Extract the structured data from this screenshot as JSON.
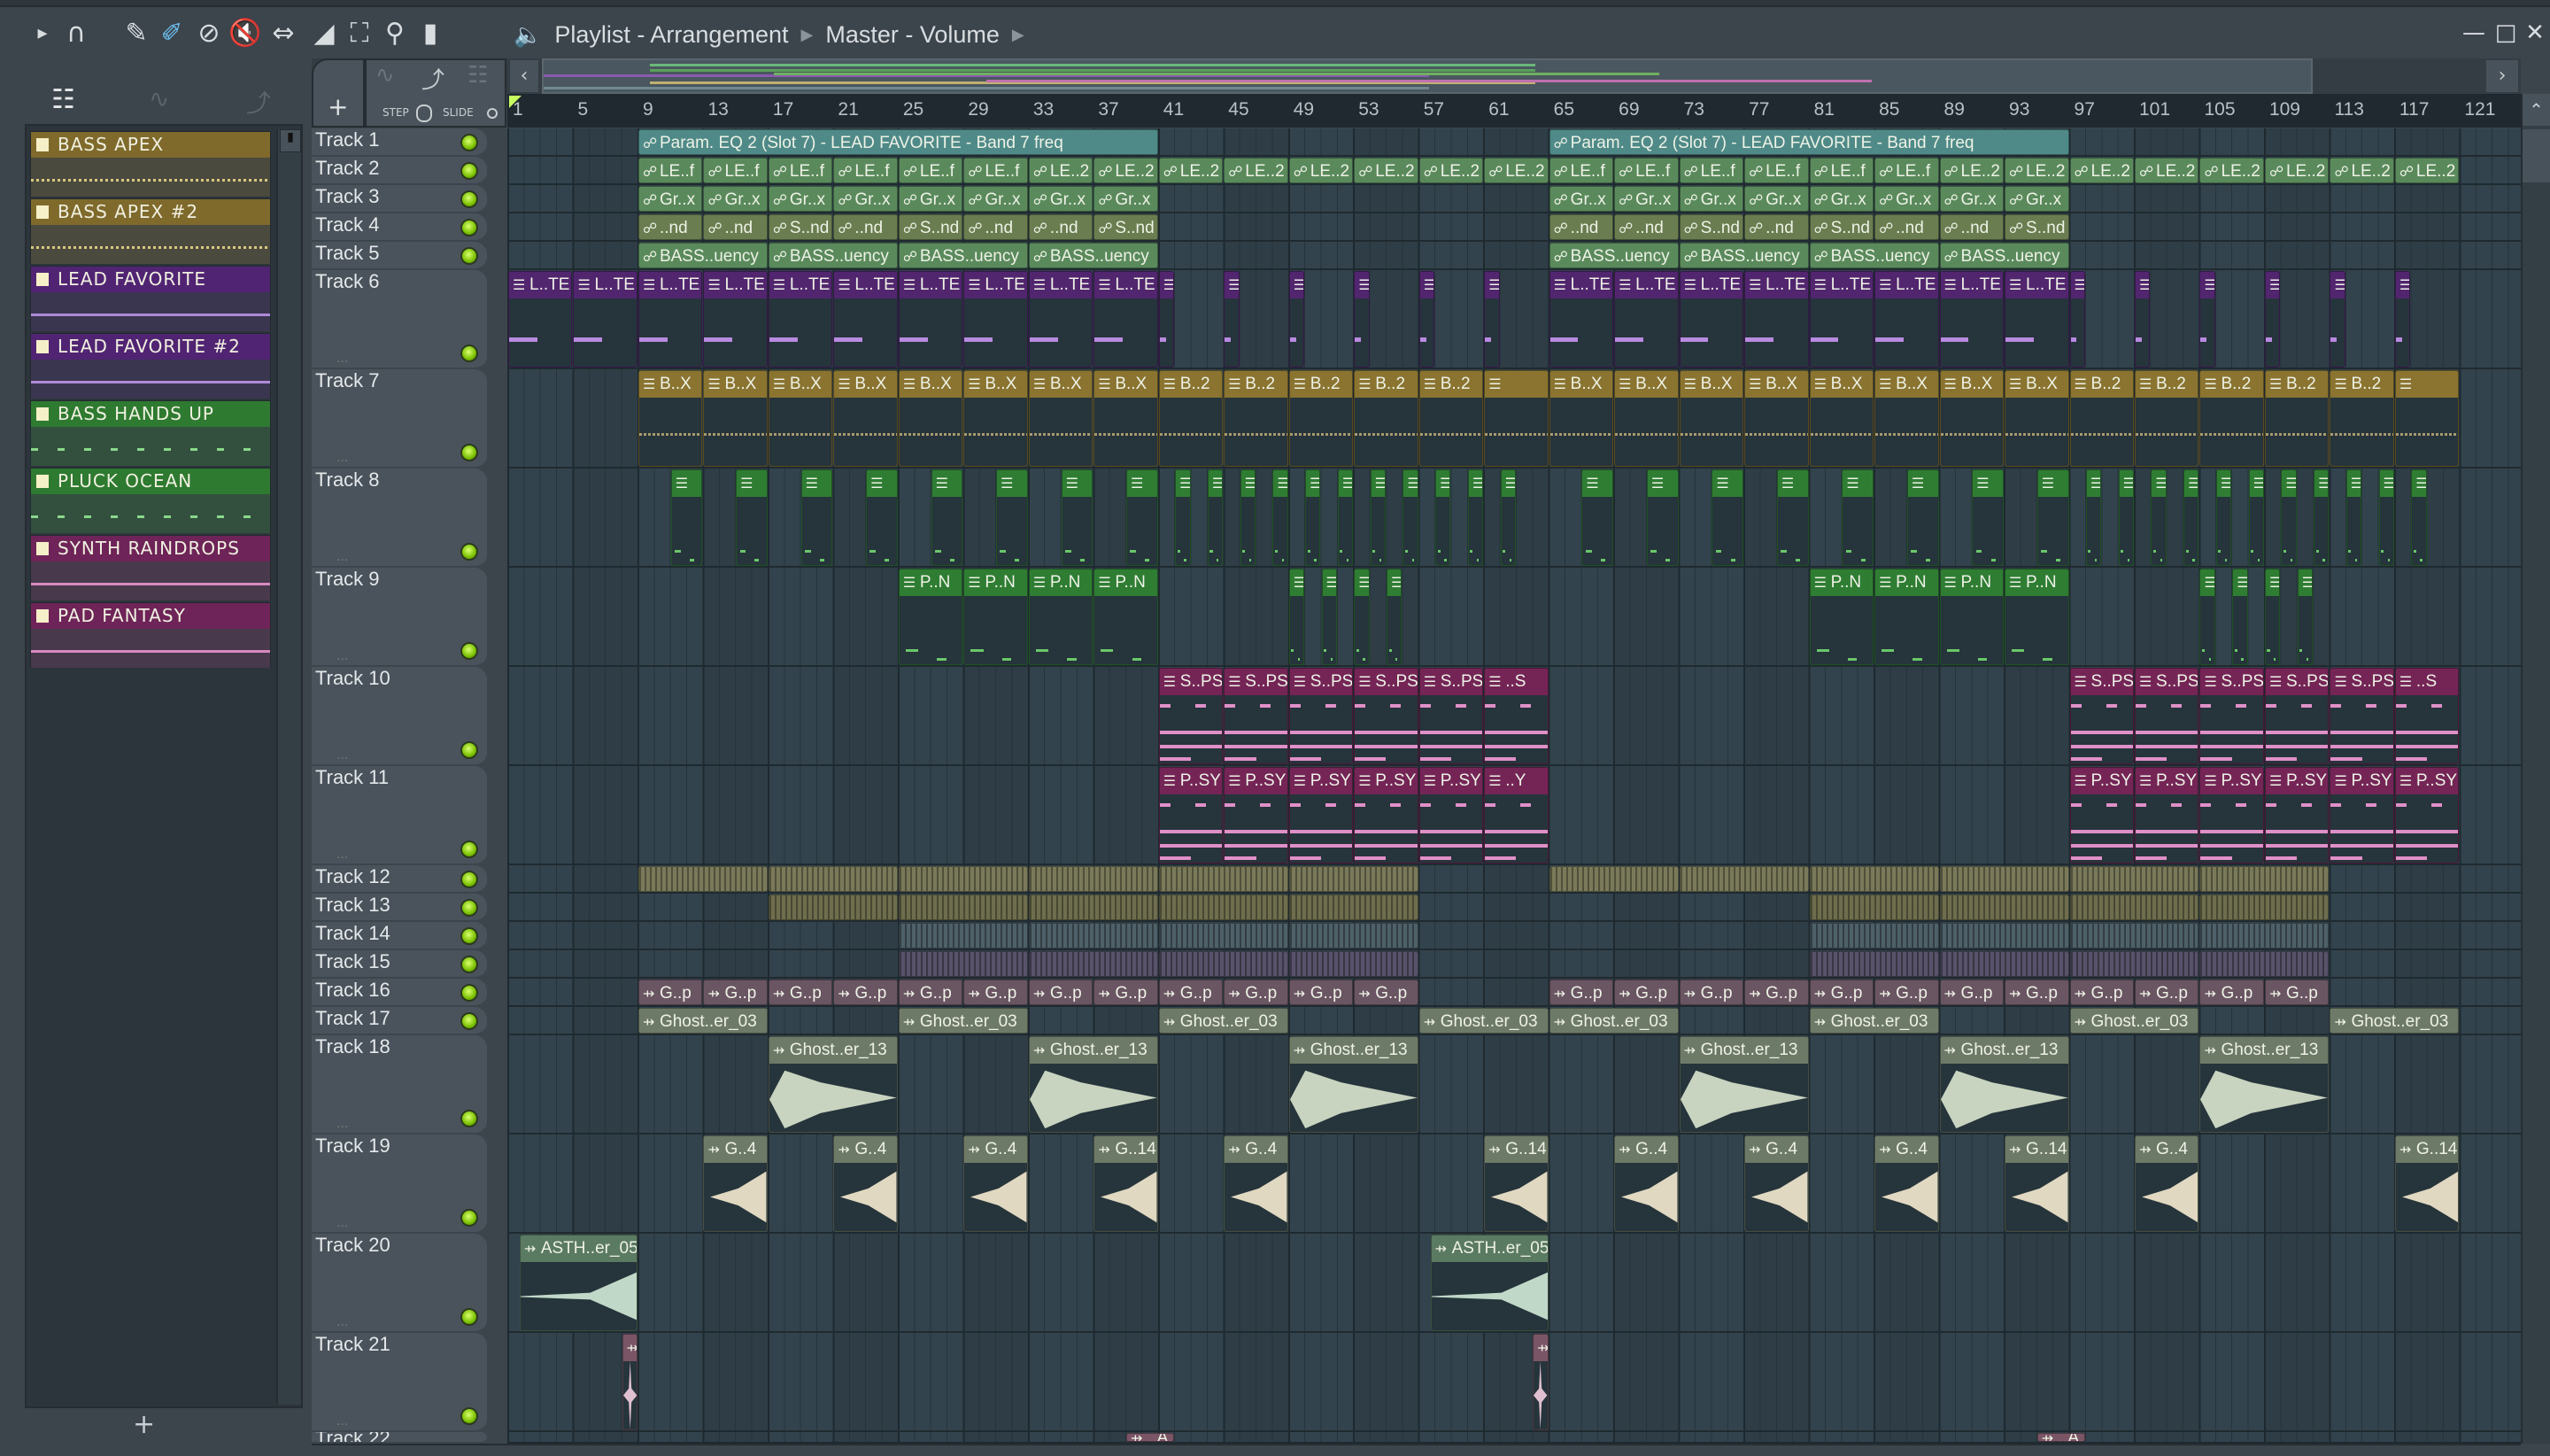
{
  "window": {
    "title_parts": [
      "Playlist - Arrangement",
      "Master - Volume"
    ]
  },
  "toolbar_icons": [
    "play-arrow-icon",
    "magnet-snap-icon",
    "pencil-icon",
    "paint-brush-icon",
    "delete-icon",
    "mute-icon",
    "slip-icon",
    "slice-icon",
    "select-icon",
    "zoom-icon",
    "playback-icon",
    "speaker-icon"
  ],
  "second_toolbar": {
    "step_label": "STEP",
    "slide_label": "SLIDE",
    "add_label": "+"
  },
  "channels": [
    {
      "name": "BASS APEX",
      "color": "#7f6a2c",
      "body": "#4b4a3f"
    },
    {
      "name": "BASS APEX #2",
      "color": "#7f6a2c",
      "body": "#4b4a3f"
    },
    {
      "name": "LEAD FAVORITE",
      "color": "#512473",
      "body": "#3b3650"
    },
    {
      "name": "LEAD FAVORITE #2",
      "color": "#512473",
      "body": "#3b3650"
    },
    {
      "name": "BASS HANDS UP",
      "color": "#2e7a30",
      "body": "#33503f"
    },
    {
      "name": "PLUCK OCEAN",
      "color": "#2e7a30",
      "body": "#33503f"
    },
    {
      "name": "SYNTH RAINDROPS",
      "color": "#6e2458",
      "body": "#48394d"
    },
    {
      "name": "PAD FANTASY",
      "color": "#6e2458",
      "body": "#48394d"
    }
  ],
  "ruler_labels": [
    "1",
    "5",
    "9",
    "13",
    "17",
    "21",
    "25",
    "29",
    "33",
    "37",
    "41",
    "45",
    "49",
    "53",
    "57",
    "61",
    "65",
    "69",
    "73",
    "77",
    "81",
    "85",
    "89",
    "93",
    "97",
    "101",
    "105",
    "109",
    "113",
    "117",
    "121"
  ],
  "palette": {
    "autoTeal": "#4f8a88",
    "autoGreen": "#5a8a5c",
    "autoOlive": "#6a7d50",
    "purple": "#52256f",
    "gold": "#8a7430",
    "green": "#2f7d33",
    "pink": "#742556",
    "olive": "#7a7a5a",
    "olive2": "#6e6e4e",
    "blue": "#4e6068",
    "violet": "#58526a",
    "mauve": "#6a5562",
    "ghost": "#6e7a68",
    "asth": "#5b7a62",
    "rose": "#7a5566"
  },
  "tracks": [
    {
      "name": "Track 1",
      "groups": [
        {
          "start": 9,
          "len": 32,
          "step": 32,
          "kind": "autoTeal",
          "labels": [
            "Param. EQ 2 (Slot 7) - LEAD FAVORITE - Band 7 freq"
          ]
        },
        {
          "start": 65,
          "len": 32,
          "step": 32,
          "kind": "autoTeal",
          "labels": [
            "Param. EQ 2 (Slot 7) - LEAD FAVORITE - Band 7 freq"
          ]
        }
      ]
    },
    {
      "name": "Track 2",
      "groups": [
        {
          "start": 9,
          "len": 4,
          "step": 4,
          "kind": "autoGreen",
          "labels": [
            "LE..f",
            "LE..f",
            "LE..f",
            "LE..f",
            "LE..f",
            "LE..f",
            "LE..2",
            "LE..2",
            "LE..2",
            "LE..2",
            "LE..2",
            "LE..2",
            "LE..2",
            "LE..2"
          ]
        },
        {
          "start": 65,
          "len": 4,
          "step": 4,
          "kind": "autoGreen",
          "labels": [
            "LE..f",
            "LE..f",
            "LE..f",
            "LE..f",
            "LE..f",
            "LE..f",
            "LE..2",
            "LE..2",
            "LE..2",
            "LE..2",
            "LE..2",
            "LE..2",
            "LE..2",
            "LE..2"
          ]
        }
      ]
    },
    {
      "name": "Track 3",
      "groups": [
        {
          "start": 9,
          "len": 4,
          "step": 4,
          "kind": "autoGreen",
          "labels": [
            "Gr..x",
            "Gr..x",
            "Gr..x",
            "Gr..x",
            "Gr..x",
            "Gr..x",
            "Gr..x",
            "Gr..x"
          ]
        },
        {
          "start": 65,
          "len": 4,
          "step": 4,
          "kind": "autoGreen",
          "labels": [
            "Gr..x",
            "Gr..x",
            "Gr..x",
            "Gr..x",
            "Gr..x",
            "Gr..x",
            "Gr..x",
            "Gr..x"
          ]
        }
      ]
    },
    {
      "name": "Track 4",
      "groups": [
        {
          "start": 9,
          "len": 4,
          "step": 4,
          "kind": "autoOlive",
          "labels": [
            "..nd",
            "..nd",
            "S..nd",
            "..nd",
            "S..nd",
            "..nd",
            "..nd",
            "S..nd"
          ]
        },
        {
          "start": 65,
          "len": 4,
          "step": 4,
          "kind": "autoOlive",
          "labels": [
            "..nd",
            "..nd",
            "S..nd",
            "..nd",
            "S..nd",
            "..nd",
            "..nd",
            "S..nd"
          ]
        }
      ]
    },
    {
      "name": "Track 5",
      "groups": [
        {
          "start": 9,
          "len": 8,
          "step": 8,
          "kind": "autoGreen",
          "labels": [
            "BASS..uency",
            "BASS..uency",
            "BASS..uency",
            "BASS..uency"
          ]
        },
        {
          "start": 65,
          "len": 8,
          "step": 8,
          "kind": "autoGreen",
          "labels": [
            "BASS..uency",
            "BASS..uency",
            "BASS..uency",
            "BASS..uency"
          ]
        }
      ]
    },
    {
      "name": "Track 6",
      "groups": [
        {
          "start": 1,
          "len": 4,
          "step": 4,
          "kind": "purple",
          "labels": [
            "L..TE",
            "L..TE",
            "L..TE",
            "L..TE",
            "L..TE",
            "L..TE",
            "L..TE",
            "L..TE",
            "L..TE",
            "L..TE"
          ]
        },
        {
          "start": 41,
          "len": 1,
          "step": 4,
          "kind": "purple",
          "labels": [
            "",
            "",
            "",
            "",
            "",
            ""
          ]
        },
        {
          "start": 65,
          "len": 4,
          "step": 4,
          "kind": "purple",
          "labels": [
            "L..TE",
            "L..TE",
            "L..TE",
            "L..TE",
            "L..TE",
            "L..TE",
            "L..TE",
            "L..TE"
          ]
        },
        {
          "start": 97,
          "len": 1,
          "step": 4,
          "kind": "purple",
          "labels": [
            "",
            "",
            "",
            "",
            "",
            ""
          ]
        }
      ]
    },
    {
      "name": "Track 7",
      "groups": [
        {
          "start": 9,
          "len": 4,
          "step": 4,
          "kind": "gold",
          "labels": [
            "B..X",
            "B..X",
            "B..X",
            "B..X",
            "B..X",
            "B..X",
            "B..X",
            "B..X",
            "B..2",
            "B..2",
            "B..2",
            "B..2",
            "B..2",
            ""
          ]
        },
        {
          "start": 65,
          "len": 4,
          "step": 4,
          "kind": "gold",
          "labels": [
            "B..X",
            "B..X",
            "B..X",
            "B..X",
            "B..X",
            "B..X",
            "B..X",
            "B..X",
            "B..2",
            "B..2",
            "B..2",
            "B..2",
            "B..2",
            ""
          ]
        }
      ]
    },
    {
      "name": "Track 8",
      "groups": [
        {
          "start": 11,
          "len": 2,
          "step": 4,
          "kind": "green",
          "labels": [
            "",
            "",
            "",
            "",
            "",
            "",
            "",
            ""
          ]
        },
        {
          "start": 42,
          "len": 1,
          "step": 2,
          "kind": "green",
          "labels": [
            "",
            "",
            "",
            "",
            "",
            "",
            "",
            "",
            "",
            "",
            ""
          ]
        },
        {
          "start": 67,
          "len": 2,
          "step": 4,
          "kind": "green",
          "labels": [
            "",
            "",
            "",
            "",
            "",
            "",
            "",
            ""
          ]
        },
        {
          "start": 98,
          "len": 1,
          "step": 2,
          "kind": "green",
          "labels": [
            "",
            "",
            "",
            "",
            "",
            "",
            "",
            "",
            "",
            "",
            ""
          ]
        }
      ]
    },
    {
      "name": "Track 9",
      "groups": [
        {
          "start": 25,
          "len": 4,
          "step": 4,
          "kind": "green",
          "labels": [
            "P..N",
            "P..N",
            "P..N",
            "P..N"
          ]
        },
        {
          "start": 49,
          "len": 1,
          "step": 2,
          "kind": "green",
          "labels": [
            "",
            "",
            "",
            ""
          ]
        },
        {
          "start": 81,
          "len": 4,
          "step": 4,
          "kind": "green",
          "labels": [
            "P..N",
            "P..N",
            "P..N",
            "P..N"
          ]
        },
        {
          "start": 105,
          "len": 1,
          "step": 2,
          "kind": "green",
          "labels": [
            "",
            "",
            "",
            ""
          ]
        }
      ]
    },
    {
      "name": "Track 10",
      "groups": [
        {
          "start": 41,
          "len": 4,
          "step": 4,
          "kind": "pink",
          "labels": [
            "S..PS",
            "S..PS",
            "S..PS",
            "S..PS",
            "S..PS",
            "..S"
          ]
        },
        {
          "start": 97,
          "len": 4,
          "step": 4,
          "kind": "pink",
          "labels": [
            "S..PS",
            "S..PS",
            "S..PS",
            "S..PS",
            "S..PS",
            "..S"
          ]
        }
      ]
    },
    {
      "name": "Track 11",
      "groups": [
        {
          "start": 41,
          "len": 4,
          "step": 4,
          "kind": "pink",
          "labels": [
            "P..SY",
            "P..SY",
            "P..SY",
            "P..SY",
            "P..SY",
            "..Y"
          ]
        },
        {
          "start": 97,
          "len": 4,
          "step": 4,
          "kind": "pink",
          "labels": [
            "P..SY",
            "P..SY",
            "P..SY",
            "P..SY",
            "P..SY",
            "P..SY"
          ]
        }
      ]
    },
    {
      "name": "Track 12",
      "groups": [
        {
          "start": 9,
          "len": 8,
          "step": 8,
          "kind": "olive",
          "labels": [
            "",
            "",
            "",
            "",
            "",
            ""
          ]
        },
        {
          "start": 65,
          "len": 8,
          "step": 8,
          "kind": "olive",
          "labels": [
            "",
            "",
            "",
            "",
            "",
            ""
          ]
        }
      ]
    },
    {
      "name": "Track 13",
      "groups": [
        {
          "start": 17,
          "len": 8,
          "step": 8,
          "kind": "olive2",
          "labels": [
            "",
            "",
            "",
            "",
            ""
          ]
        },
        {
          "start": 81,
          "len": 8,
          "step": 8,
          "kind": "olive2",
          "labels": [
            "",
            "",
            "",
            ""
          ]
        }
      ]
    },
    {
      "name": "Track 14",
      "groups": [
        {
          "start": 25,
          "len": 8,
          "step": 8,
          "kind": "blue",
          "labels": [
            "",
            "",
            "",
            ""
          ]
        },
        {
          "start": 81,
          "len": 8,
          "step": 8,
          "kind": "blue",
          "labels": [
            "",
            "",
            "",
            ""
          ]
        }
      ]
    },
    {
      "name": "Track 15",
      "groups": [
        {
          "start": 25,
          "len": 8,
          "step": 8,
          "kind": "violet",
          "labels": [
            "",
            "",
            "",
            ""
          ]
        },
        {
          "start": 81,
          "len": 8,
          "step": 8,
          "kind": "violet",
          "labels": [
            "",
            "",
            "",
            ""
          ]
        }
      ]
    },
    {
      "name": "Track 16",
      "groups": [
        {
          "start": 9,
          "len": 4,
          "step": 4,
          "kind": "mauve",
          "labels": [
            "G..p",
            "G..p",
            "G..p",
            "G..p",
            "G..p",
            "G..p",
            "G..p",
            "G..p",
            "G..p",
            "G..p",
            "G..p",
            "G..p"
          ]
        },
        {
          "start": 65,
          "len": 4,
          "step": 4,
          "kind": "mauve",
          "labels": [
            "G..p",
            "G..p",
            "G..p",
            "G..p",
            "G..p",
            "G..p",
            "G..p",
            "G..p",
            "G..p",
            "G..p",
            "G..p",
            "G..p"
          ]
        }
      ]
    },
    {
      "name": "Track 17",
      "groups": [
        {
          "start": 9,
          "len": 8,
          "step": 16,
          "kind": "ghost",
          "labels": [
            "Ghost..er_03",
            "Ghost..er_03",
            "Ghost..er_03",
            "Ghost..er_03"
          ]
        },
        {
          "start": 65,
          "len": 8,
          "step": 16,
          "kind": "ghost",
          "labels": [
            "Ghost..er_03",
            "Ghost..er_03",
            "Ghost..er_03",
            "Ghost..er_03"
          ]
        }
      ]
    },
    {
      "name": "Track 18",
      "groups": [
        {
          "start": 17,
          "len": 8,
          "step": 16,
          "kind": "ghost",
          "labels": [
            "Ghost..er_13",
            "Ghost..er_13",
            "Ghost..er_13"
          ]
        },
        {
          "start": 73,
          "len": 8,
          "step": 16,
          "kind": "ghost",
          "labels": [
            "Ghost..er_13",
            "Ghost..er_13",
            "Ghost..er_13"
          ]
        }
      ]
    },
    {
      "name": "Track 19",
      "groups": [
        {
          "start": 13,
          "len": 4,
          "step": 8,
          "kind": "ghost",
          "labels": [
            "G..4",
            "G..4",
            "G..4",
            "G..14",
            "G..4"
          ]
        },
        {
          "start": 61,
          "len": 4,
          "step": 8,
          "kind": "ghost",
          "labels": [
            "G..14",
            "G..4",
            "G..4",
            "G..4",
            "G..14",
            "G..4"
          ]
        },
        {
          "start": 117,
          "len": 4,
          "step": 4,
          "kind": "ghost",
          "labels": [
            "G..14"
          ]
        }
      ]
    },
    {
      "name": "Track 20",
      "groups": [
        {
          "start": 1.7,
          "len": 7.3,
          "step": 8,
          "kind": "asth",
          "labels": [
            "ASTH..er_05"
          ]
        },
        {
          "start": 57.7,
          "len": 7.3,
          "step": 8,
          "kind": "asth",
          "labels": [
            "ASTH..er_05"
          ]
        }
      ]
    },
    {
      "name": "Track 21",
      "groups": [
        {
          "start": 8,
          "len": 1,
          "step": 1,
          "kind": "rose",
          "labels": [
            ""
          ]
        },
        {
          "start": 64,
          "len": 1,
          "step": 1,
          "kind": "rose",
          "labels": [
            ""
          ]
        }
      ]
    },
    {
      "name": "Track 22",
      "groups": [
        {
          "start": 39,
          "len": 3,
          "step": 3,
          "kind": "rose",
          "labels": [
            "..A.."
          ]
        },
        {
          "start": 95,
          "len": 3,
          "step": 3,
          "kind": "rose",
          "labels": [
            "..A.."
          ]
        }
      ]
    }
  ]
}
